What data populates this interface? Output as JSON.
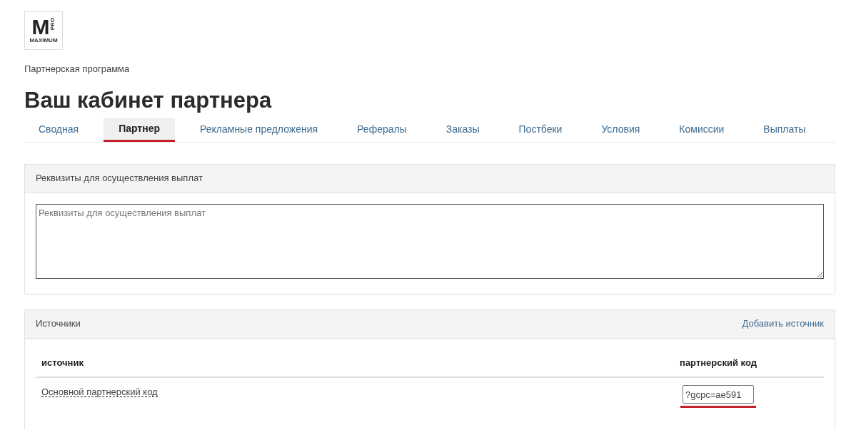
{
  "logo": {
    "letter": "M",
    "badge": "PRO",
    "wordmark": "MAXIMUM"
  },
  "breadcrumb": "Партнерская программа",
  "title": "Ваш кабинет партнера",
  "tabs": [
    {
      "label": "Сводная",
      "selected": false
    },
    {
      "label": "Партнер",
      "selected": true
    },
    {
      "label": "Рекламные предложения",
      "selected": false
    },
    {
      "label": "Рефералы",
      "selected": false
    },
    {
      "label": "Заказы",
      "selected": false
    },
    {
      "label": "Постбеки",
      "selected": false
    },
    {
      "label": "Условия",
      "selected": false
    },
    {
      "label": "Комиссии",
      "selected": false
    },
    {
      "label": "Выплаты",
      "selected": false
    }
  ],
  "payment_panel": {
    "title": "Реквизиты для осуществления выплат",
    "placeholder": "Реквизиты для осуществления выплат"
  },
  "sources_panel": {
    "title": "Источники",
    "action": "Добавить источник",
    "columns": [
      "источник",
      "партнерский код"
    ],
    "rows": [
      {
        "source": "Основной партнерский код",
        "code": "?gcpc=ae591",
        "highlighted": true
      }
    ]
  }
}
